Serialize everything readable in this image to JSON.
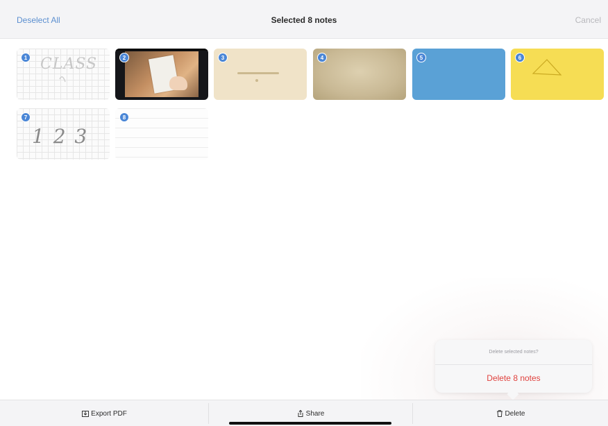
{
  "header": {
    "deselect_label": "Deselect All",
    "title": "Selected 8 notes",
    "cancel_label": "Cancel"
  },
  "notes": [
    {
      "badge": "1",
      "style": "grid",
      "handwriting": "CLASS"
    },
    {
      "badge": "2",
      "style": "photo"
    },
    {
      "badge": "3",
      "style": "cream"
    },
    {
      "badge": "4",
      "style": "parchment"
    },
    {
      "badge": "5",
      "style": "blue"
    },
    {
      "badge": "6",
      "style": "yellow"
    },
    {
      "badge": "7",
      "style": "grid",
      "handwriting": "1 2 3"
    },
    {
      "badge": "8",
      "style": "lined"
    }
  ],
  "popover": {
    "message": "Delete selected notes?",
    "delete_label": "Delete 8 notes"
  },
  "toolbar": {
    "export_label": "Export PDF",
    "share_label": "Share",
    "delete_label": "Delete"
  },
  "colors": {
    "accent": "#4a86d6",
    "destructive": "#e0423e",
    "note_blue": "#5aa1d6",
    "note_yellow": "#f6dd54"
  }
}
